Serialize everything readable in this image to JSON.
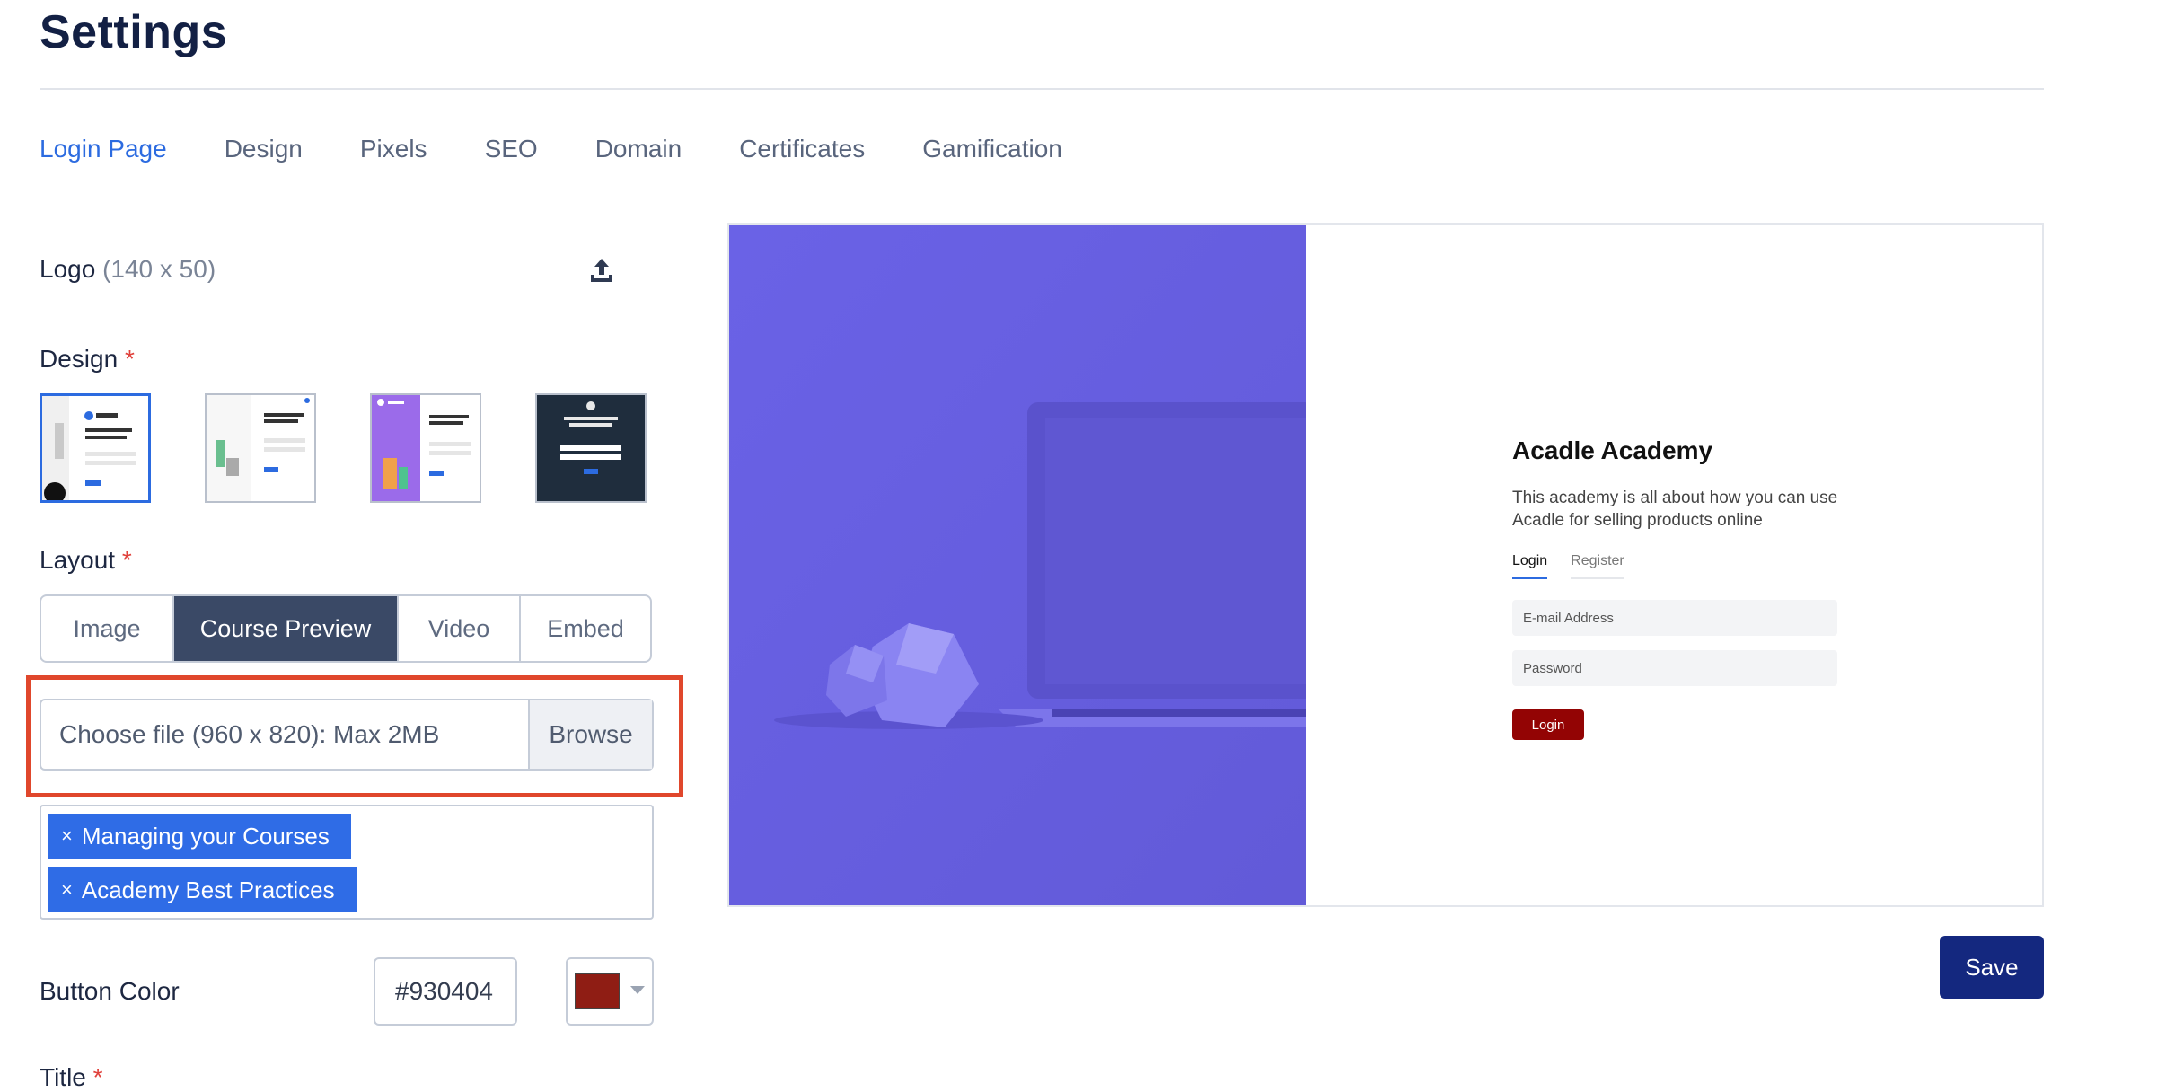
{
  "page": {
    "title": "Settings"
  },
  "tabs": [
    {
      "label": "Login Page",
      "active": true
    },
    {
      "label": "Design"
    },
    {
      "label": "Pixels"
    },
    {
      "label": "SEO"
    },
    {
      "label": "Domain"
    },
    {
      "label": "Certificates"
    },
    {
      "label": "Gamification"
    }
  ],
  "logo": {
    "label": "Logo",
    "hint": "(140 x 50)",
    "upload_icon": "upload-icon"
  },
  "design": {
    "label": "Design",
    "required_mark": "*",
    "selected_index": 0,
    "thumbnails": [
      "design-1",
      "design-2",
      "design-3",
      "design-4"
    ]
  },
  "layout": {
    "label": "Layout",
    "required_mark": "*",
    "options": [
      "Image",
      "Course Preview",
      "Video",
      "Embed"
    ],
    "selected": "Course Preview"
  },
  "file_input": {
    "placeholder": "Choose file (960 x 820): Max 2MB",
    "browse_label": "Browse"
  },
  "course_tags": [
    {
      "label": "Managing your Courses",
      "remove": "×"
    },
    {
      "label": "Academy Best Practices",
      "remove": "×"
    }
  ],
  "button_color": {
    "label": "Button Color",
    "value": "#930404",
    "swatch": "#8f1d14"
  },
  "title_field": {
    "label": "Title",
    "required_mark": "*"
  },
  "preview": {
    "background_color": "#6b62e4",
    "title": "Acadle Academy",
    "description": "This academy is all about how you can use Acadle for selling products online",
    "tabs": [
      "Login",
      "Register"
    ],
    "email_placeholder": "E-mail Address",
    "password_placeholder": "Password",
    "login_button": "Login"
  },
  "save_label": "Save",
  "colors": {
    "accent": "#2c6be0",
    "save": "#14287f",
    "highlight": "#e0472c"
  }
}
